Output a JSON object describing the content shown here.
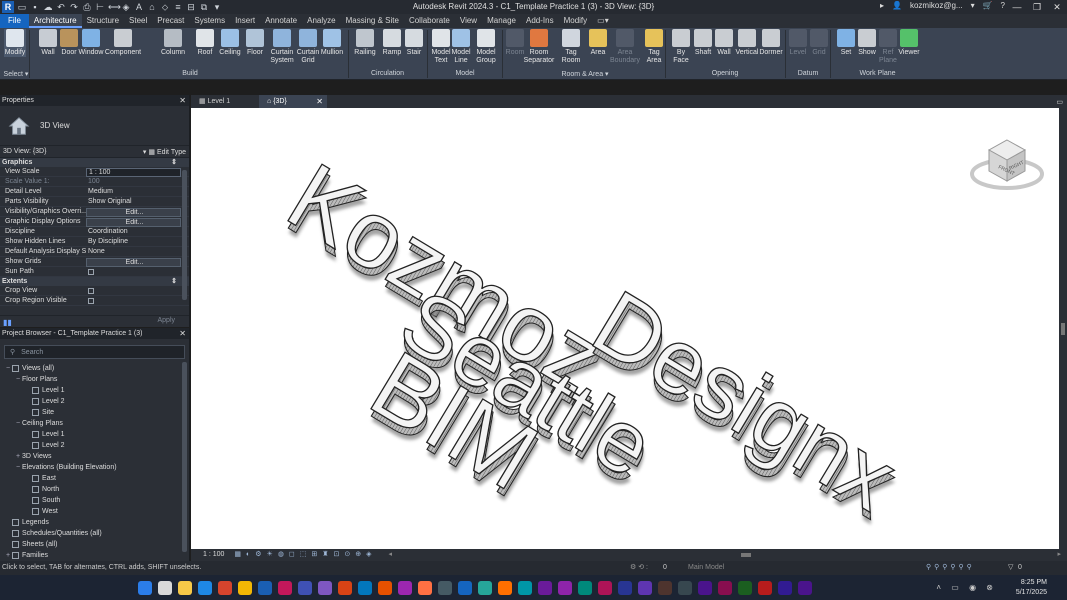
{
  "app": {
    "title": "Autodesk Revit 2024.3 - C1_Template Practice 1 (3) - 3D View: {3D}",
    "user": "kozmikoz@g...",
    "logo_letter": "R"
  },
  "tabs": [
    "File",
    "Architecture",
    "Structure",
    "Steel",
    "Precast",
    "Systems",
    "Insert",
    "Annotate",
    "Analyze",
    "Massing & Site",
    "Collaborate",
    "View",
    "Manage",
    "Add-Ins",
    "Modify"
  ],
  "ribbon": {
    "buttons": [
      {
        "label": "Modify",
        "color": "#dfe6ee"
      },
      {
        "label": "Wall",
        "color": "#c7ccd3"
      },
      {
        "label": "Door",
        "color": "#b9935c"
      },
      {
        "label": "Window",
        "color": "#7fb2e5"
      },
      {
        "label": "Component",
        "color": "#c9cdd2"
      },
      {
        "label": "Column",
        "color": "#b5bcc4"
      },
      {
        "label": "Roof",
        "color": "#e0e4e8"
      },
      {
        "label": "Ceiling",
        "color": "#9bc0e6"
      },
      {
        "label": "Floor",
        "color": "#b0c4d8"
      },
      {
        "label": "Curtain System",
        "color": "#8fb4dc"
      },
      {
        "label": "Curtain Grid",
        "color": "#8fb4dc"
      },
      {
        "label": "Mullion",
        "color": "#9fc2e6"
      },
      {
        "label": "Railing",
        "color": "#bfc6ce"
      },
      {
        "label": "Ramp",
        "color": "#d6dbe0"
      },
      {
        "label": "Stair",
        "color": "#d6dbe0"
      },
      {
        "label": "Model Text",
        "color": "#e0e4e8"
      },
      {
        "label": "Model Line",
        "color": "#9fc2e6"
      },
      {
        "label": "Model Group",
        "color": "#e0e4e8"
      },
      {
        "label": "Room",
        "color": "#7a8290"
      },
      {
        "label": "Room Separator",
        "color": "#e07840"
      },
      {
        "label": "Tag Room",
        "color": "#d0d6de"
      },
      {
        "label": "Area",
        "color": "#e6c25a"
      },
      {
        "label": "Area Boundary",
        "color": "#7a8290"
      },
      {
        "label": "Tag Area",
        "color": "#e6c25a"
      },
      {
        "label": "By Face",
        "color": "#c9cdd2"
      },
      {
        "label": "Shaft",
        "color": "#c9cdd2"
      },
      {
        "label": "Wall",
        "color": "#c9cdd2"
      },
      {
        "label": "Vertical",
        "color": "#c9cdd2"
      },
      {
        "label": "Dormer",
        "color": "#c9cdd2"
      },
      {
        "label": "Level",
        "color": "#7a8290"
      },
      {
        "label": "Grid",
        "color": "#7a8290"
      },
      {
        "label": "Set",
        "color": "#7fb2e5"
      },
      {
        "label": "Show",
        "color": "#c9cdd2"
      },
      {
        "label": "Ref Plane",
        "color": "#7a8290"
      },
      {
        "label": "Viewer",
        "color": "#55c16a"
      }
    ],
    "panels": [
      "Select ▾",
      "Build",
      "Circulation",
      "Model",
      "Room & Area ▾",
      "Opening",
      "Datum",
      "Work Plane"
    ]
  },
  "properties": {
    "header": "Properties",
    "type_name": "3D View",
    "view_selector": "3D View: {3D}",
    "edit_type": "Edit Type",
    "groups": {
      "graphics": "Graphics",
      "extents": "Extents"
    },
    "rows": [
      {
        "k": "View Scale",
        "v": "1 : 100",
        "kind": "input"
      },
      {
        "k": "Scale Value    1:",
        "v": "100",
        "kind": "dim"
      },
      {
        "k": "Detail Level",
        "v": "Medium"
      },
      {
        "k": "Parts Visibility",
        "v": "Show Original"
      },
      {
        "k": "Visibility/Graphics Overri...",
        "v": "Edit...",
        "kind": "button"
      },
      {
        "k": "Graphic Display Options",
        "v": "Edit...",
        "kind": "button"
      },
      {
        "k": "Discipline",
        "v": "Coordination"
      },
      {
        "k": "Show Hidden Lines",
        "v": "By Discipline"
      },
      {
        "k": "Default Analysis Display S...",
        "v": "None"
      },
      {
        "k": "Show Grids",
        "v": "Edit...",
        "kind": "button"
      },
      {
        "k": "Sun Path",
        "v": "",
        "kind": "check"
      }
    ],
    "extent_rows": [
      {
        "k": "Crop View",
        "v": "",
        "kind": "check"
      },
      {
        "k": "Crop Region Visible",
        "v": "",
        "kind": "check"
      }
    ],
    "apply": "Apply"
  },
  "browser": {
    "header": "Project Browser - C1_Template Practice 1 (3)",
    "search_placeholder": "Search",
    "tree": [
      {
        "t": "Views (all)",
        "lvl": 0,
        "tog": "−",
        "icon": true
      },
      {
        "t": "Floor Plans",
        "lvl": 1,
        "tog": "−"
      },
      {
        "t": "Level 1",
        "lvl": 2,
        "icon": true
      },
      {
        "t": "Level 2",
        "lvl": 2,
        "icon": true
      },
      {
        "t": "Site",
        "lvl": 2,
        "icon": true
      },
      {
        "t": "Ceiling Plans",
        "lvl": 1,
        "tog": "−"
      },
      {
        "t": "Level 1",
        "lvl": 2,
        "icon": true
      },
      {
        "t": "Level 2",
        "lvl": 2,
        "icon": true
      },
      {
        "t": "3D Views",
        "lvl": 1,
        "tog": "+"
      },
      {
        "t": "Elevations (Building Elevation)",
        "lvl": 1,
        "tog": "−"
      },
      {
        "t": "East",
        "lvl": 2,
        "icon": true
      },
      {
        "t": "North",
        "lvl": 2,
        "icon": true
      },
      {
        "t": "South",
        "lvl": 2,
        "icon": true
      },
      {
        "t": "West",
        "lvl": 2,
        "icon": true
      },
      {
        "t": "Legends",
        "lvl": 0,
        "icon": true
      },
      {
        "t": "Schedules/Quantities (all)",
        "lvl": 0,
        "icon": true
      },
      {
        "t": "Sheets (all)",
        "lvl": 0,
        "icon": true
      },
      {
        "t": "Families",
        "lvl": 0,
        "tog": "+",
        "icon": true
      }
    ]
  },
  "viewtabs": [
    "Level 1",
    "{3D}"
  ],
  "model_text": [
    "Kozmoz",
    "Seattle",
    "BIM",
    "Designx"
  ],
  "viewcube": {
    "front": "FRONT",
    "right": "RIGHT"
  },
  "viewcontrol": {
    "scale": "1 : 100"
  },
  "statusbar": {
    "text": "Click to select, TAB for alternates, CTRL adds, SHIFT unselects.",
    "model": "Main Model",
    "sel_count": "0",
    "filter_count": "0"
  },
  "taskbar": {
    "time": "8:25 PM",
    "date": "5/17/2025"
  }
}
